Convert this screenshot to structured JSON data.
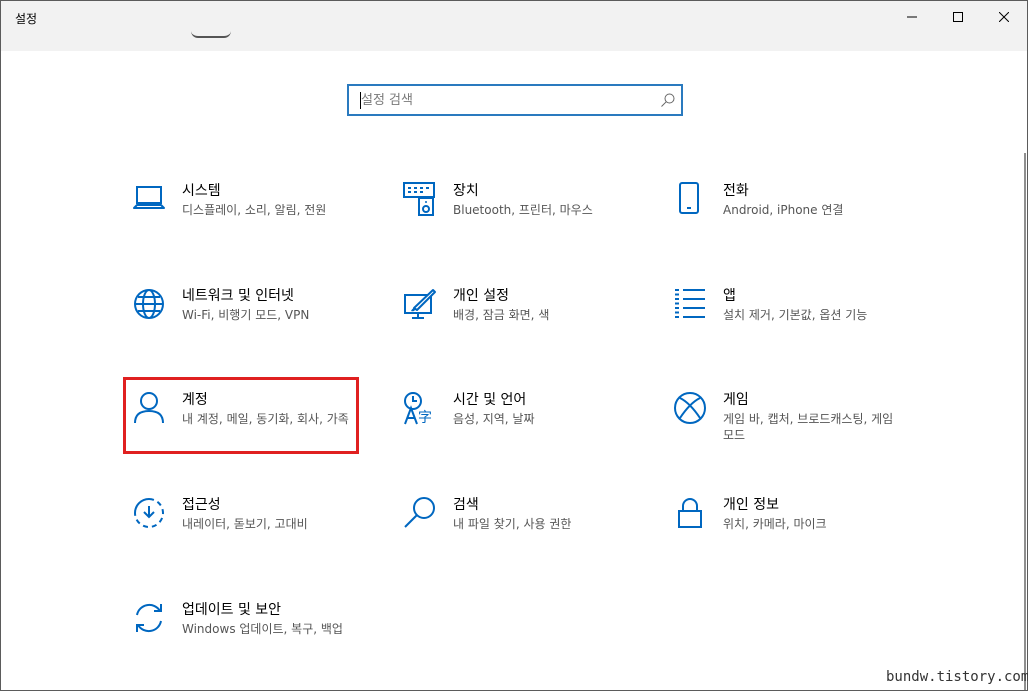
{
  "window": {
    "title": "설정",
    "controls": {
      "minimize": "minimize-icon",
      "maximize": "maximize-icon",
      "close": "close-icon"
    }
  },
  "search": {
    "placeholder": "설정 검색",
    "icon": "search-icon"
  },
  "accent_color": "#0067c0",
  "highlight_color": "#e02020",
  "tiles": [
    {
      "title": "시스템",
      "desc": "디스플레이, 소리, 알림, 전원",
      "icon": "laptop-icon"
    },
    {
      "title": "장치",
      "desc": "Bluetooth, 프린터, 마우스",
      "icon": "devices-icon"
    },
    {
      "title": "전화",
      "desc": "Android, iPhone 연결",
      "icon": "phone-icon"
    },
    {
      "title": "네트워크 및 인터넷",
      "desc": "Wi-Fi, 비행기 모드, VPN",
      "icon": "globe-icon"
    },
    {
      "title": "개인 설정",
      "desc": "배경, 잠금 화면, 색",
      "icon": "personalization-icon"
    },
    {
      "title": "앱",
      "desc": "설치 제거, 기본값, 옵션 기능",
      "icon": "apps-list-icon"
    },
    {
      "title": "계정",
      "desc": "내 계정, 메일, 동기화, 회사, 가족",
      "icon": "person-icon"
    },
    {
      "title": "시간 및 언어",
      "desc": "음성, 지역, 날짜",
      "icon": "time-language-icon"
    },
    {
      "title": "게임",
      "desc": "게임 바, 캡처, 브로드캐스팅, 게임 모드",
      "icon": "xbox-icon"
    },
    {
      "title": "접근성",
      "desc": "내레이터, 돋보기, 고대비",
      "icon": "ease-of-access-icon"
    },
    {
      "title": "검색",
      "desc": "내 파일 찾기, 사용 권한",
      "icon": "magnifier-icon"
    },
    {
      "title": "개인 정보",
      "desc": "위치, 카메라, 마이크",
      "icon": "lock-icon"
    },
    {
      "title": "업데이트 및 보안",
      "desc": "Windows 업데이트, 복구, 백업",
      "icon": "update-icon"
    }
  ],
  "watermark": "bundw.tistory.com"
}
